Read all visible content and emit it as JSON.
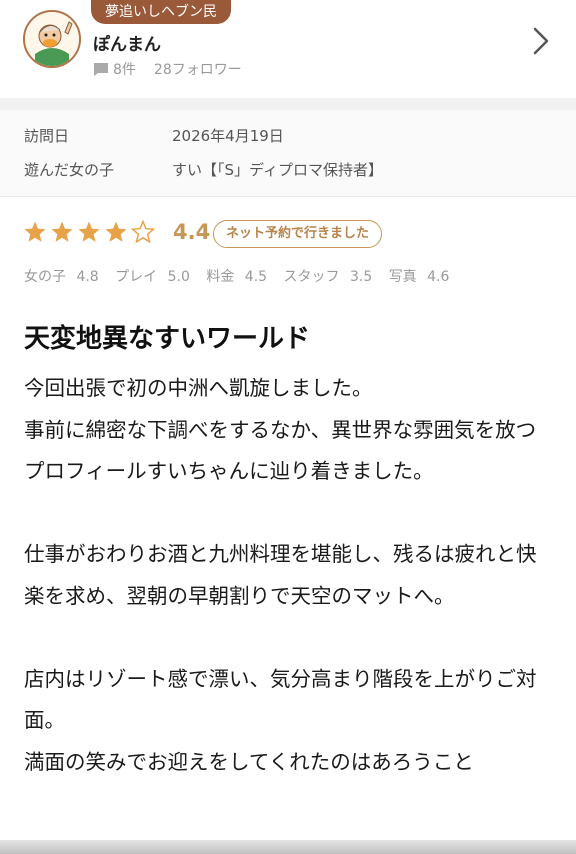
{
  "reviewer": {
    "title_badge": "夢追いしヘブン民",
    "name": "ぽんまん",
    "review_count": "8件",
    "followers": "28フォロワー",
    "avatar_icon": "cartoon-character-avatar",
    "chevron_icon": "chevron-right-icon"
  },
  "visit": {
    "date_label": "訪問日",
    "date_value": "2026年4月19日",
    "girl_label": "遊んだ女の子",
    "girl_value": "すい【「S」ディプロマ保持者】"
  },
  "rating": {
    "stars_filled": 4,
    "stars_total": 5,
    "score": "4.4",
    "badge": "ネット予約で行きました",
    "star_color": "#e8a24a",
    "subscores": [
      {
        "label": "女の子",
        "value": "4.8"
      },
      {
        "label": "プレイ",
        "value": "5.0"
      },
      {
        "label": "料金",
        "value": "4.5"
      },
      {
        "label": "スタッフ",
        "value": "3.5"
      },
      {
        "label": "写真",
        "value": "4.6"
      }
    ]
  },
  "review": {
    "title": "天変地異なすいワールド",
    "paragraphs": [
      "今回出張で初の中洲へ凱旋しました。",
      "事前に綿密な下調べをするなか、異世界な雰囲気を放つプロフィールすいちゃんに辿り着きました。",
      "",
      "仕事がおわりお酒と九州料理を堪能し、残るは疲れと快楽を求め、翌朝の早朝割りで天空のマットへ。",
      "",
      "店内はリゾート感で漂い、気分高まり階段を上がりご対面。",
      "満面の笑みでお迎えをしてくれたのはあろうこと"
    ]
  }
}
